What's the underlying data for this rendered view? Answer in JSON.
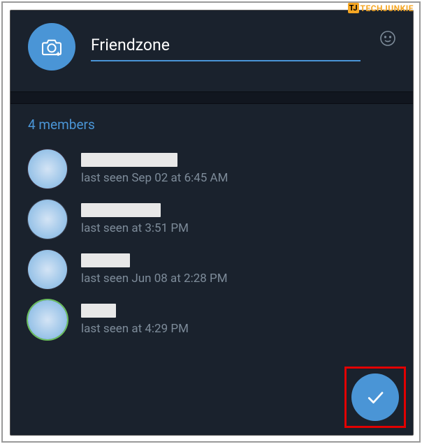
{
  "watermark": {
    "tj": "TJ",
    "text": "TECHJUNKIE"
  },
  "header": {
    "group_name": "Friendzone"
  },
  "members": {
    "count_label": "4 members",
    "list": [
      {
        "name_width": 138,
        "status": "last seen Sep 02 at 6:45 AM",
        "ring_class": "ring-1"
      },
      {
        "name_width": 114,
        "status": "last seen at 3:51 PM",
        "ring_class": "ring-2"
      },
      {
        "name_width": 70,
        "status": "last seen Jun 08 at 2:28 PM",
        "ring_class": "ring-3"
      },
      {
        "name_width": 50,
        "status": "last seen at 4:29 PM",
        "ring_class": "ring-4"
      }
    ]
  }
}
